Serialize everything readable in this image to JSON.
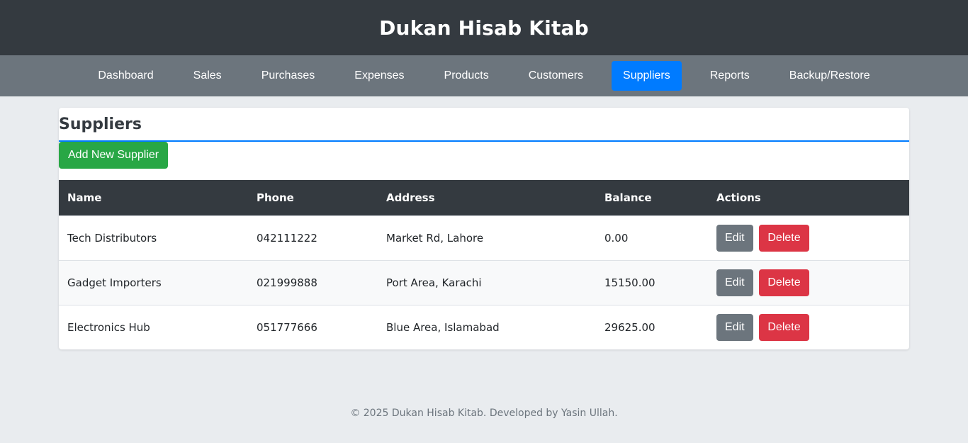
{
  "header": {
    "title": "Dukan Hisab Kitab"
  },
  "nav": {
    "items": [
      {
        "label": "Dashboard"
      },
      {
        "label": "Sales"
      },
      {
        "label": "Purchases"
      },
      {
        "label": "Expenses"
      },
      {
        "label": "Products"
      },
      {
        "label": "Customers"
      },
      {
        "label": "Suppliers",
        "active": true
      },
      {
        "label": "Reports"
      },
      {
        "label": "Backup/Restore"
      }
    ]
  },
  "page": {
    "title": "Suppliers",
    "add_button_label": "Add New Supplier"
  },
  "table": {
    "columns": [
      "Name",
      "Phone",
      "Address",
      "Balance",
      "Actions"
    ],
    "rows": [
      {
        "name": "Tech Distributors",
        "phone": "042111222",
        "address": "Market Rd, Lahore",
        "balance": "0.00",
        "balance_highlight": false
      },
      {
        "name": "Gadget Importers",
        "phone": "021999888",
        "address": "Port Area, Karachi",
        "balance": "15150.00",
        "balance_highlight": true
      },
      {
        "name": "Electronics Hub",
        "phone": "051777666",
        "address": "Blue Area, Islamabad",
        "balance": "29625.00",
        "balance_highlight": true
      }
    ],
    "edit_label": "Edit",
    "delete_label": "Delete"
  },
  "footer": {
    "text": "© 2025 Dukan Hisab Kitab. Developed by Yasin Ullah."
  },
  "colors": {
    "header_bg": "#343a40",
    "nav_bg": "#6c757d",
    "accent": "#007bff",
    "success": "#28a745",
    "danger": "#dc3545"
  }
}
